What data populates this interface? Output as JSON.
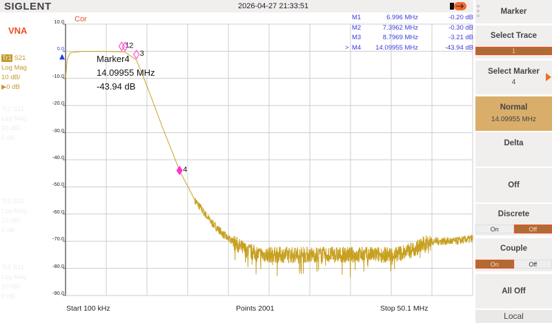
{
  "header": {
    "brand": "SIGLENT",
    "datetime": "2026-04-27 21:33:51",
    "usb_icon": "usb-icon"
  },
  "left": {
    "mode": "VNA",
    "traces": [
      {
        "id": "Tr1",
        "param": "S21",
        "format": "Log Mag",
        "scale": "10 dB/",
        "ref": "▶0 dB",
        "active": true
      },
      {
        "id": "Tr2",
        "param": "S11",
        "format": "Log Mag",
        "scale": "10 dB/",
        "ref": "0 dB",
        "active": false
      },
      {
        "id": "Tr3",
        "param": "S11",
        "format": "Log Mag",
        "scale": "10 dB/",
        "ref": "0 dB",
        "active": false
      },
      {
        "id": "Tr4",
        "param": "S11",
        "format": "Log Mag",
        "scale": "10 dB/",
        "ref": "0 dB",
        "active": false
      }
    ]
  },
  "plot": {
    "cor": "Cor",
    "start": "Start  100 kHz",
    "points": "Points  2001",
    "stop": "Stop  50.1 MHz",
    "marker_readout": {
      "name": "Marker4",
      "freq": "14.09955 MHz",
      "value": "-43.94 dB"
    },
    "markers": [
      {
        "sel": "",
        "name": "M1",
        "freq": "6.996 MHz",
        "value": "-0.20 dB"
      },
      {
        "sel": "",
        "name": "M2",
        "freq": "7.3962 MHz",
        "value": "-0.30 dB"
      },
      {
        "sel": "",
        "name": "M3",
        "freq": "8.7969 MHz",
        "value": "-3.21 dB"
      },
      {
        "sel": ">",
        "name": "M4",
        "freq": "14.09955 MHz",
        "value": "-43.94 dB"
      }
    ]
  },
  "chart_data": {
    "type": "line",
    "xlabel": "",
    "ylabel": "",
    "xlim_mhz": [
      0.1,
      50.1
    ],
    "ylim": [
      -90,
      10
    ],
    "yticks": [
      "10.0",
      "0.0",
      "-10.0",
      "-20.0",
      "-30.0",
      "-40.0",
      "-50.0",
      "-60.0",
      "-70.0",
      "-80.0",
      "-90.0"
    ],
    "grid": true,
    "trace_color": "#c8a020",
    "marker_color": "#ff33cc",
    "series": [
      {
        "x_mhz": [
          0.1,
          0.3,
          0.7,
          2,
          5,
          7,
          7.4,
          8.8,
          10,
          12,
          14.1,
          16,
          18,
          20,
          22,
          24,
          30,
          35,
          40,
          42,
          45,
          48,
          50.1
        ],
        "y_db": [
          -10,
          -3,
          -0.5,
          -0.1,
          -0.1,
          -0.2,
          -0.3,
          -3.21,
          -12,
          -28,
          -43.94,
          -55,
          -63,
          -69,
          -73,
          -75,
          -75,
          -75,
          -75,
          -74,
          -70,
          -70,
          -69
        ]
      }
    ],
    "marker_points": [
      {
        "label": "1",
        "x_mhz": 6.996,
        "y_db": -0.2
      },
      {
        "label": "2",
        "x_mhz": 7.3962,
        "y_db": -0.3
      },
      {
        "label": "3",
        "x_mhz": 8.7969,
        "y_db": -3.21
      },
      {
        "label": "4",
        "x_mhz": 14.09955,
        "y_db": -43.94
      }
    ]
  },
  "softkeys": {
    "title": "Marker",
    "select_trace": "Select Trace",
    "trace_value": "1",
    "select_marker": "Select Marker",
    "marker_value": "4",
    "normal": "Normal",
    "normal_value": "14.09955 MHz",
    "delta": "Delta",
    "off": "Off",
    "discrete": "Discrete",
    "couple": "Couple",
    "on_label": "On",
    "off_label": "Off",
    "all_off": "All Off",
    "local": "Local",
    "accent": "#b06b35",
    "normal_bg": "#d9ae6a"
  }
}
